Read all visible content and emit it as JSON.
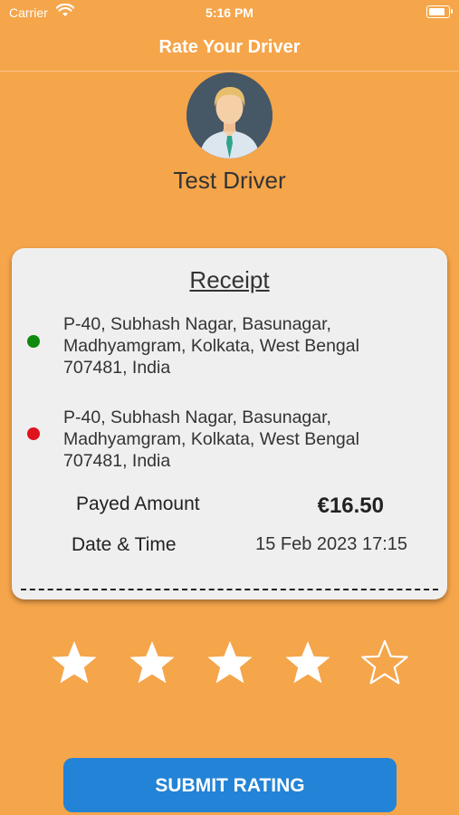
{
  "status_bar": {
    "carrier": "Carrier",
    "time": "5:16 PM",
    "battery_level": 0.95,
    "wifi_icon": "wifi-icon"
  },
  "header": {
    "title": "Rate Your Driver"
  },
  "driver": {
    "name": "Test Driver",
    "avatar_icon": "driver-avatar"
  },
  "receipt": {
    "title": "Receipt",
    "pickup": {
      "line1": "P-40, Subhash Nagar, Basunagar,",
      "line2": "Madhyamgram, Kolkata, West Bengal",
      "line3": "707481, India",
      "color": "#0E8A0E"
    },
    "dropoff": {
      "line1": "P-40, Subhash Nagar, Basunagar,",
      "line2": "Madhyamgram, Kolkata, West Bengal",
      "line3": "707481, India",
      "color": "#E0141E"
    },
    "amount_label": "Payed Amount",
    "amount_value": "€16.50",
    "datetime_label": "Date & Time",
    "datetime_value": "15 Feb 2023 17:15"
  },
  "rating": {
    "value": 4,
    "max": 5
  },
  "submit_label": "SUBMIT RATING",
  "colors": {
    "background": "#F5A54A",
    "button": "#2383D6",
    "card": "#EFEFEF"
  }
}
